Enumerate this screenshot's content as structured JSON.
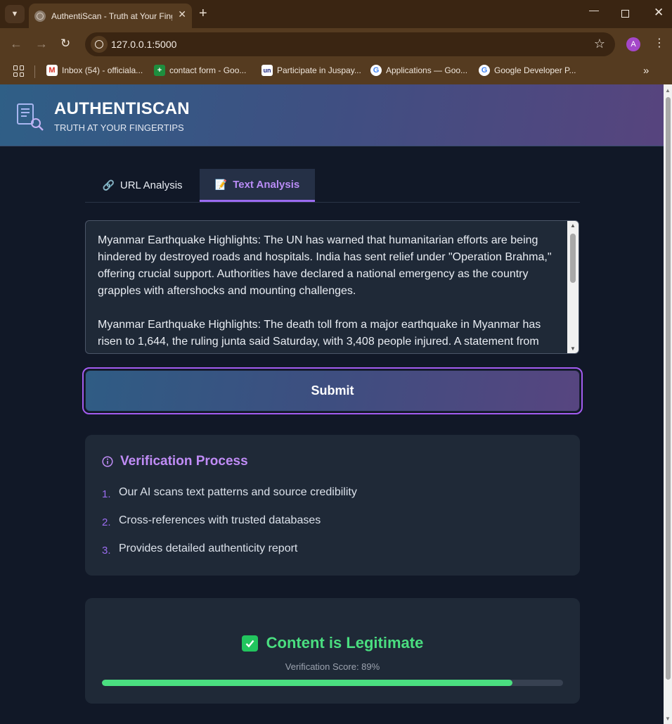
{
  "browser": {
    "tab_title": "AuthentiScan - Truth at Your Fingertips",
    "url": "127.0.0.1:5000",
    "avatar_letter": "A",
    "bookmarks": [
      {
        "label": "Inbox (54) - officiala...",
        "icon": "gmail-icon"
      },
      {
        "label": "contact form - Goo...",
        "icon": "sheets-icon"
      },
      {
        "label": "Participate in Juspay...",
        "icon": "unstop-icon"
      },
      {
        "label": "Applications — Goo...",
        "icon": "google-icon"
      },
      {
        "label": "Google Developer P...",
        "icon": "google-icon"
      }
    ]
  },
  "header": {
    "title": "AUTHENTISCAN",
    "tagline": "TRUTH AT YOUR FINGERTIPS"
  },
  "tabs": {
    "url_label": "URL Analysis",
    "text_label": "Text Analysis",
    "active": "text"
  },
  "input": {
    "text": "Myanmar Earthquake Highlights: The UN has warned that humanitarian efforts are being hindered by destroyed roads and hospitals. India has sent relief under \"Operation Brahma,\" offering crucial support. Authorities have declared a national emergency as the country grapples with aftershocks and mounting challenges.\n\nMyanmar Earthquake Highlights: The death toll from a major earthquake in Myanmar has risen to 1,644, the ruling junta said Saturday, with 3,408 people injured. A statement from"
  },
  "submit_label": "Submit",
  "process": {
    "title": "Verification Process",
    "steps": [
      {
        "num": "1.",
        "text": "Our AI scans text patterns and source credibility"
      },
      {
        "num": "2.",
        "text": "Cross-references with trusted databases"
      },
      {
        "num": "3.",
        "text": "Provides detailed authenticity report"
      }
    ]
  },
  "result": {
    "title": "Content is Legitimate",
    "score_text": "Verification Score: 89%",
    "score": 89
  },
  "colors": {
    "accent": "#9b6cf0",
    "success": "#4ade80",
    "background": "#111827",
    "card": "#1f2937"
  }
}
